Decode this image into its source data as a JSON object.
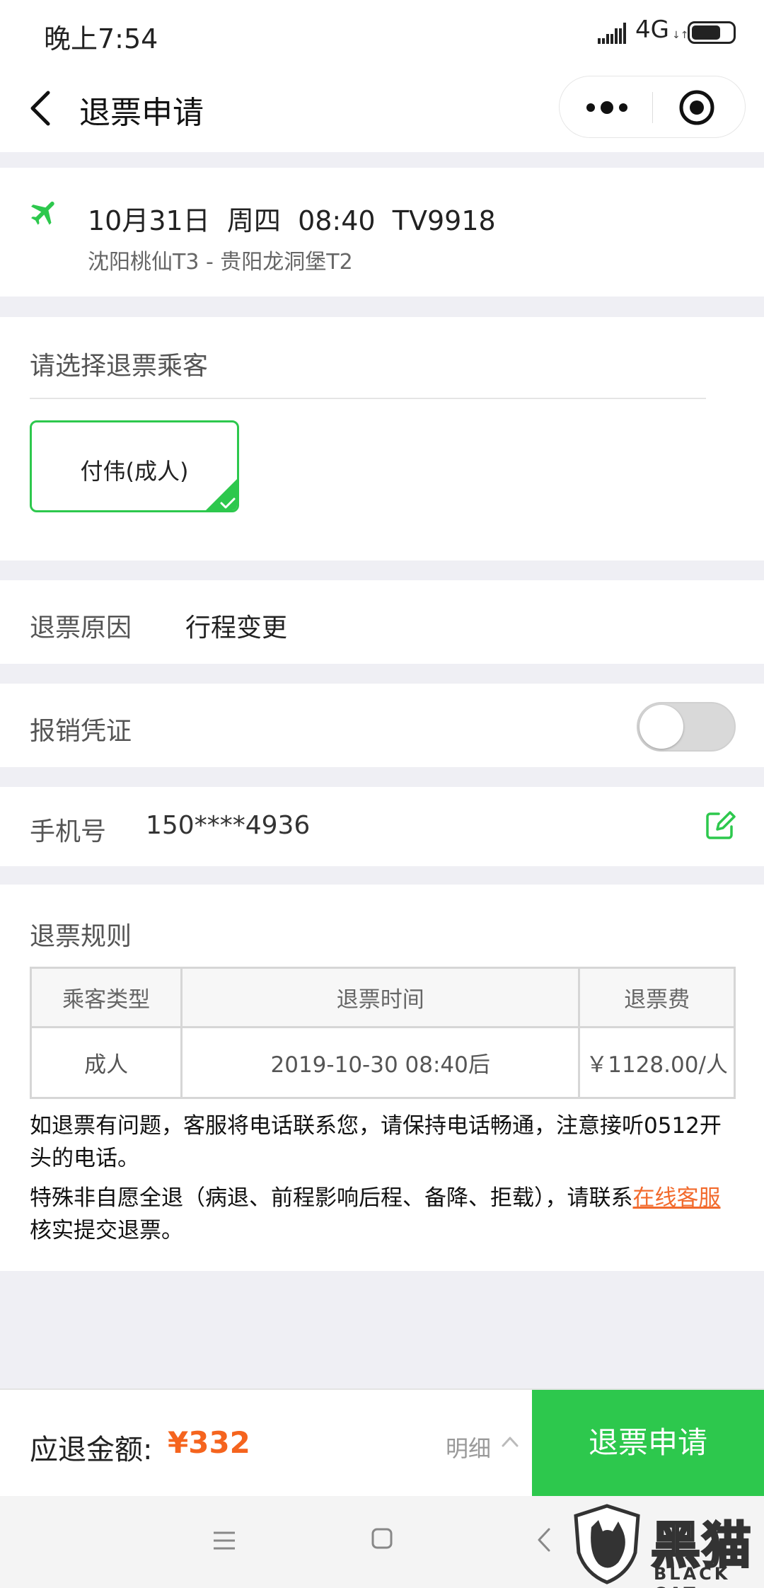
{
  "status_bar": {
    "time": "晚上7:54",
    "network": "4G",
    "network_arrows": "↓↑"
  },
  "nav": {
    "title": "退票申请"
  },
  "flight": {
    "date": "10月31日",
    "weekday": "周四",
    "time": "08:40",
    "flight_no": "TV9918",
    "route": "沈阳桃仙T3 - 贵阳龙洞堡T2"
  },
  "passengers": {
    "title": "请选择退票乘客",
    "items": [
      {
        "label": "付伟(成人)",
        "selected": true
      }
    ]
  },
  "reason": {
    "label": "退票原因",
    "value": "行程变更"
  },
  "voucher": {
    "label": "报销凭证",
    "enabled": false
  },
  "phone": {
    "label": "手机号",
    "value": "150****4936"
  },
  "rules": {
    "title": "退票规则",
    "headers": [
      "乘客类型",
      "退票时间",
      "退票费"
    ],
    "rows": [
      [
        "成人",
        "2019-10-30 08:40后",
        "￥1128.00/人"
      ]
    ],
    "note1": "如退票有问题，客服将电话联系您，请保持电话畅通，注意接听0512开头的电话。",
    "note2_before": "特殊非自愿全退（病退、前程影响后程、备降、拒载），请联系",
    "note2_link": "在线客服",
    "note2_after": "核实提交退票。"
  },
  "bottom": {
    "refund_label": "应退金额:",
    "refund_amount": "¥332",
    "detail_label": "明细",
    "submit_label": "退票申请"
  },
  "watermark": {
    "cn": "黑猫",
    "en": "BLACK CAT"
  },
  "colors": {
    "accent_green": "#2dc84d",
    "price_orange": "#f5641e",
    "link_orange": "#f26a2c"
  }
}
